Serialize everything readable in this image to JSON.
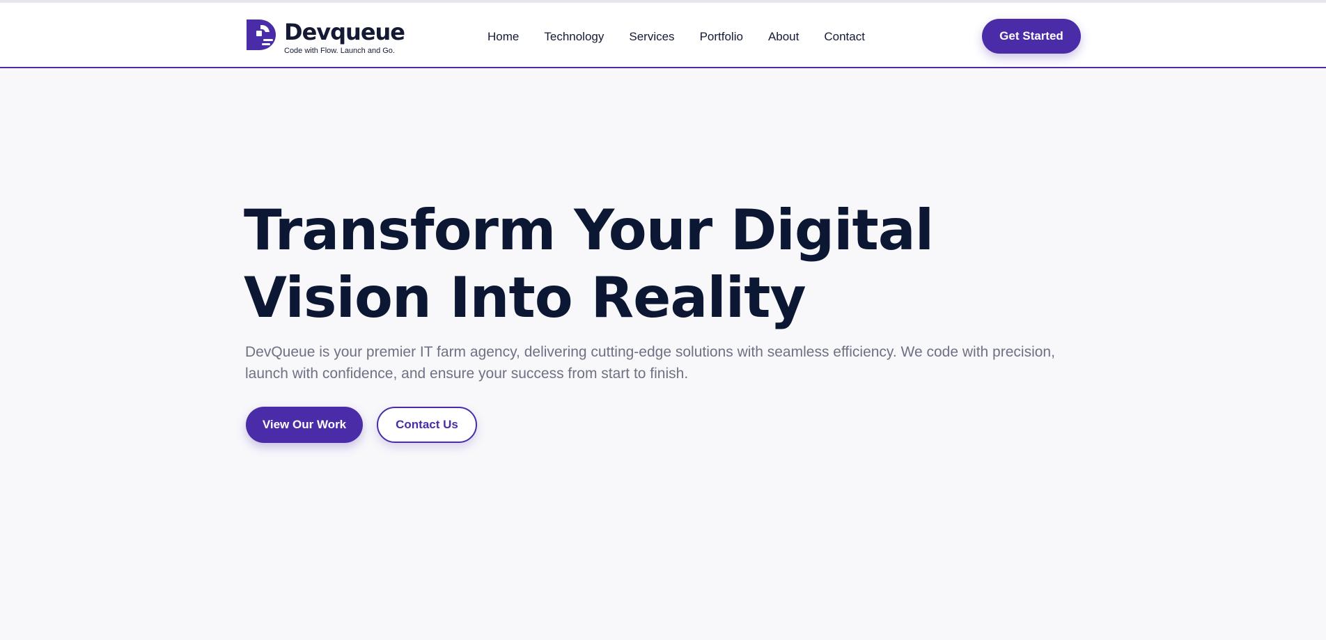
{
  "brand": {
    "name": "Devqueue",
    "tagline": "Code with Flow. Launch and Go.",
    "logo_icon": "devqueue-d-logo",
    "accent_color": "#4b2ca8",
    "dark_text_color": "#0c1733"
  },
  "nav": {
    "items": [
      {
        "label": "Home"
      },
      {
        "label": "Technology"
      },
      {
        "label": "Services"
      },
      {
        "label": "Portfolio"
      },
      {
        "label": "About"
      },
      {
        "label": "Contact"
      }
    ],
    "cta_label": "Get Started"
  },
  "hero": {
    "title_line1": "Transform Your Digital",
    "title_line2": "Vision Into Reality",
    "description": "DevQueue is your premier IT farm agency, delivering cutting-edge solutions with seamless efficiency. We code with precision, launch with confidence, and ensure your success from start to finish.",
    "primary_button": "View Our Work",
    "secondary_button": "Contact Us"
  }
}
